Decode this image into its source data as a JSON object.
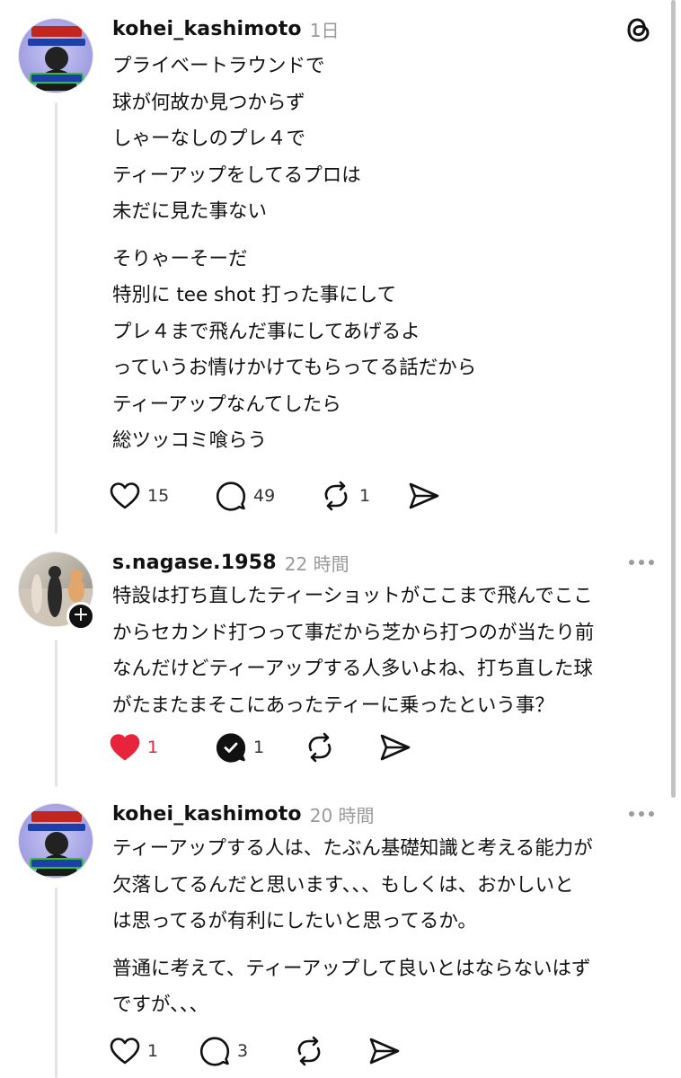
{
  "posts": [
    {
      "username": "kohei_kashimoto",
      "time": "1日",
      "avatar": "golfer-avatar",
      "lines": [
        "プライベートラウンドで",
        "球が何故か見つからず",
        "しゃーなしのプレ４で",
        "ティーアップをしてるプロは",
        "未だに見た事ない"
      ],
      "lines2": [
        "そりゃーそーだ",
        "特別に tee shot 打った事にして",
        "プレ４まで飛んだ事にしてあげるよ",
        "っていうお情けかけてもらってる話だから",
        "ティーアップなんてしたら",
        "総ツッコミ喰らう"
      ],
      "likes": "15",
      "comments": "49",
      "reposts": "1"
    },
    {
      "username": "s.nagase.1958",
      "time": "22 時間",
      "avatar": "cats-avatar",
      "lines": [
        "特設は打ち直したティーショットがここまで飛んでここ",
        "からセカンド打つって事だから芝から打つのが当たり前",
        "なんだけどティーアップする人多いよね、打ち直した球",
        "がたまたまそこにあったティーに乗ったという事？"
      ],
      "likes": "1",
      "comments": "1"
    },
    {
      "username": "kohei_kashimoto",
      "time": "20 時間",
      "avatar": "golfer-avatar",
      "lines": [
        "ティーアップする人は、たぶん基礎知識と考える能力が",
        "欠落してるんだと思います、、、もしくは、おかしいと",
        "は思ってるが有利にしたいと思ってるか。"
      ],
      "lines2": [
        "普通に考えて、ティーアップして良いとはならないはず",
        "ですが、、、"
      ],
      "likes": "1",
      "comments": "3"
    }
  ],
  "colors": {
    "text": "#111111",
    "muted": "#9a9a9a",
    "like_active": "#e8243c"
  },
  "icons": [
    "threads-logo-icon",
    "heart-icon",
    "comment-icon",
    "repost-icon",
    "share-icon",
    "more-icon",
    "follow-plus-icon"
  ]
}
